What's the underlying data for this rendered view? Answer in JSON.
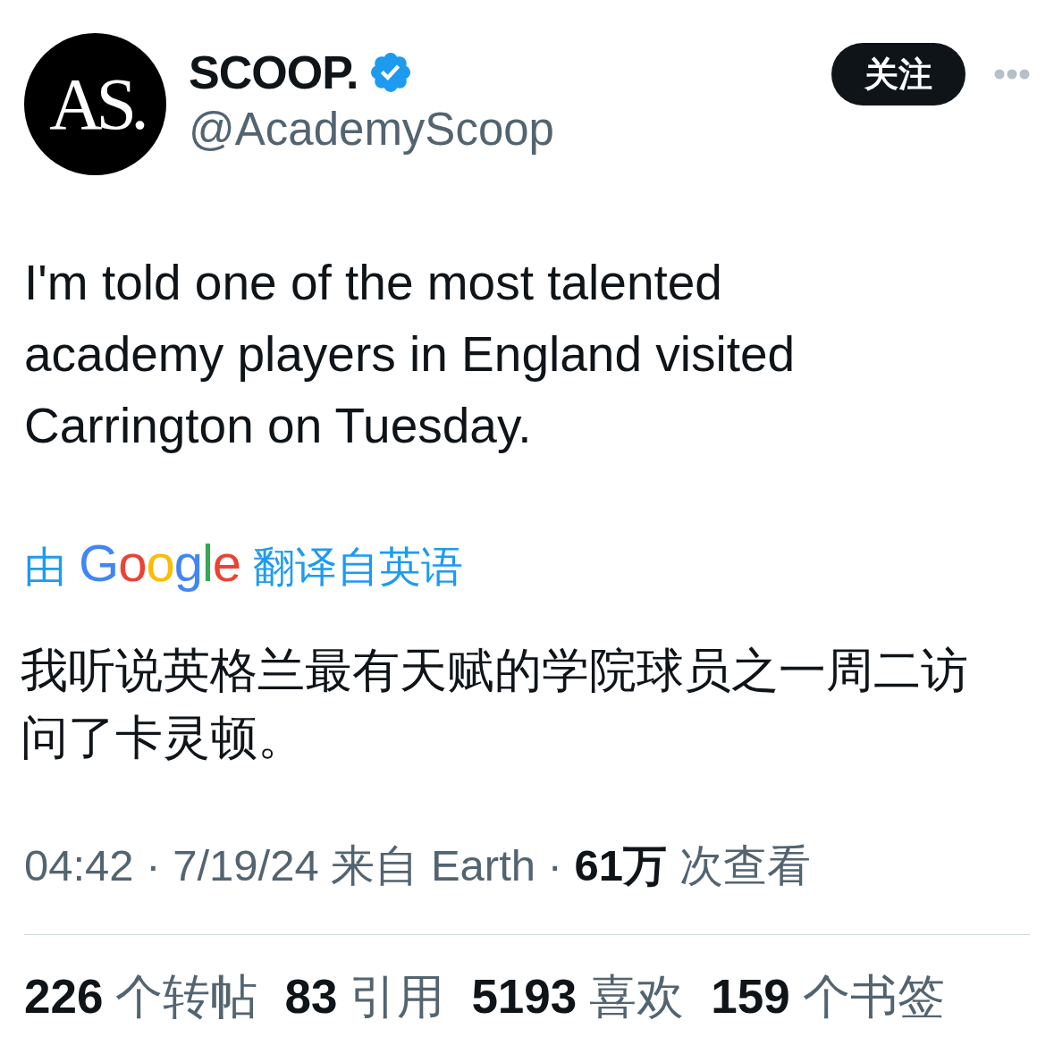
{
  "author": {
    "avatar_text": "AS.",
    "name": "SCOOP.",
    "verified": true,
    "handle": "@AcademyScoop"
  },
  "follow_button": {
    "label": "关注"
  },
  "tweet": {
    "text": "I'm told one of the most talented academy players in England visited Carrington on Tuesday."
  },
  "translation": {
    "prefix": "由",
    "brand": "Google",
    "suffix": "翻译自英语",
    "text": "我听说英格兰最有天赋的学院球员之一周二访问了卡灵顿。"
  },
  "meta": "04:42 · 7/19/24 来自 Earth · **61万** 次查看",
  "stats": [
    {
      "count": "226",
      "label": "个转帖"
    },
    {
      "count": "83",
      "label": "引用"
    },
    {
      "count": "5193",
      "label": "喜欢"
    },
    {
      "count": "159",
      "label": "个书签"
    }
  ]
}
